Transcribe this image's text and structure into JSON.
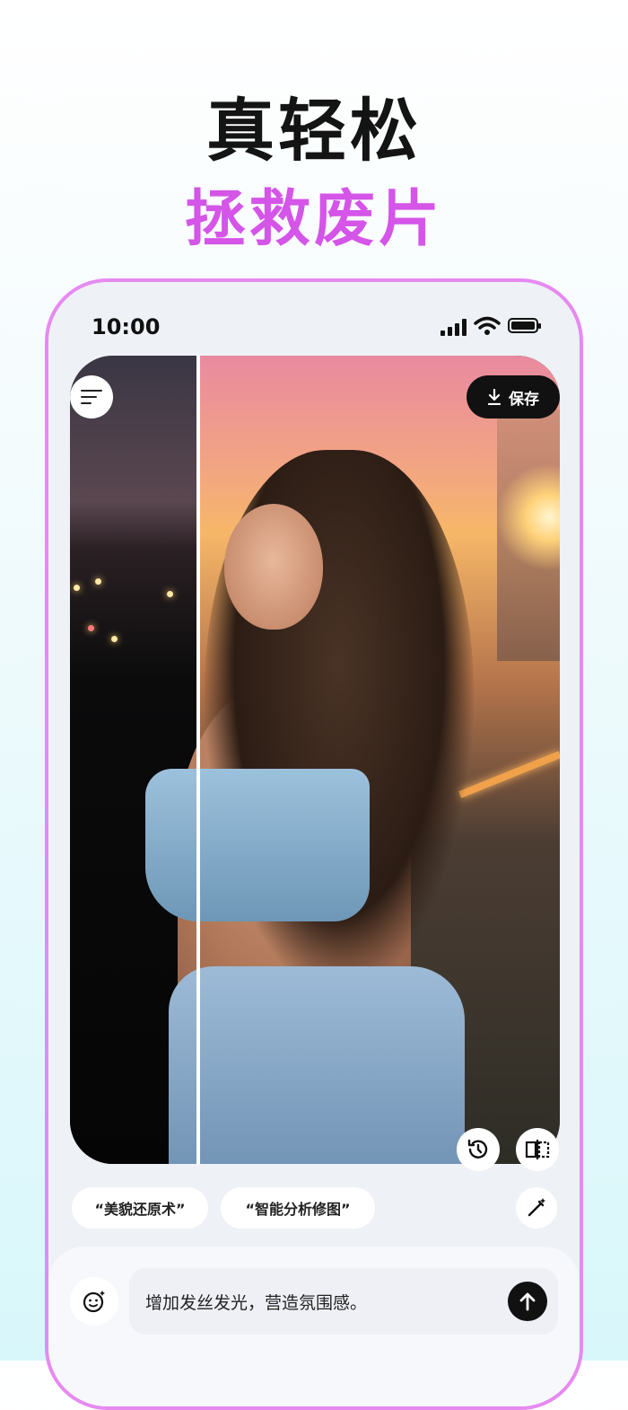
{
  "headline": {
    "title": "真轻松",
    "subtitle": "拯救废片",
    "title_color": "#141414",
    "subtitle_color": "#d455e8"
  },
  "status_bar": {
    "time": "10:00",
    "icons": [
      "signal-icon",
      "wifi-icon",
      "battery-icon"
    ]
  },
  "toolbar": {
    "menu_icon": "menu-icon",
    "save_label": "保存",
    "save_icon": "download-icon"
  },
  "photo_tools": [
    "history-icon",
    "compare-icon"
  ],
  "suggestions": [
    {
      "label": "“美貌还原术”"
    },
    {
      "label": "“智能分析修图”"
    }
  ],
  "magic_icon": "magic-wand-icon",
  "prompt": {
    "value": "增加发丝发光，营造氛围感。",
    "emoji_icon": "sparkle-face-icon",
    "send_icon": "arrow-up-icon"
  },
  "colors": {
    "frame_accent": "#e68af0",
    "button_dark": "#111111"
  }
}
